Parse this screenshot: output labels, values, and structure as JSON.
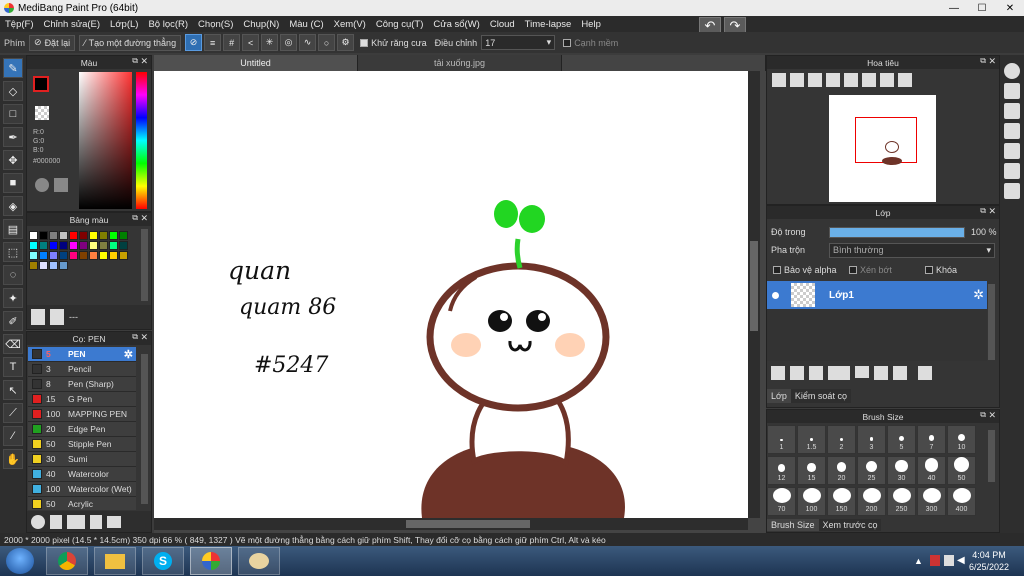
{
  "window": {
    "title": "MediBang Paint Pro (64bit)"
  },
  "menu": [
    "Tệp(F)",
    "Chỉnh sửa(E)",
    "Lớp(L)",
    "Bộ lọc(R)",
    "Chọn(S)",
    "Chụp(N)",
    "Màu (C)",
    "Xem(V)",
    "Công cụ(T)",
    "Cửa sổ(W)",
    "Cloud",
    "Time-lapse",
    "Help"
  ],
  "toolbar": {
    "label": "Phím",
    "reset": "Đặt lại",
    "make_line": "Tạo một đường thẳng",
    "antialias": "Khử răng cưa",
    "adjust_label": "Điều chỉnh",
    "adjust_value": "17",
    "smooth_edge": "Cạnh mềm"
  },
  "color_panel": {
    "title": "Màu",
    "rgb": [
      "R:0",
      "G:0",
      "B:0"
    ],
    "hex": "#000000",
    "current_color": "#000000"
  },
  "palette_panel": {
    "title": "Bảng màu",
    "colors": [
      "#ffffff",
      "#000000",
      "#808080",
      "#c0c0c0",
      "#ff0000",
      "#800000",
      "#ffff00",
      "#808000",
      "#00ff00",
      "#008000",
      "#00ffff",
      "#008080",
      "#0000ff",
      "#000080",
      "#ff00ff",
      "#800080",
      "#ffff80",
      "#808040",
      "#00ff80",
      "#004040",
      "#80ffff",
      "#0080ff",
      "#8080ff",
      "#004080",
      "#ff0080",
      "#804000",
      "#ff8040",
      "#ffff00",
      "#ffd000",
      "#c8a000",
      "#a08000",
      "#e0e0ff",
      "#a0c0ff",
      "#6699cc"
    ],
    "footer": "---"
  },
  "brush_panel": {
    "title": "Cọ: PEN",
    "brushes": [
      {
        "size": "5",
        "name": "PEN",
        "color": "#333333"
      },
      {
        "size": "3",
        "name": "Pencil",
        "color": "#333333"
      },
      {
        "size": "8",
        "name": "Pen (Sharp)",
        "color": "#333333"
      },
      {
        "size": "15",
        "name": "G Pen",
        "color": "#e02020"
      },
      {
        "size": "100",
        "name": "MAPPING PEN",
        "color": "#e02020"
      },
      {
        "size": "20",
        "name": "Edge Pen",
        "color": "#20a020"
      },
      {
        "size": "50",
        "name": "Stipple Pen",
        "color": "#f0d020"
      },
      {
        "size": "30",
        "name": "Sumi",
        "color": "#f0d020"
      },
      {
        "size": "40",
        "name": "Watercolor",
        "color": "#40b0e0"
      },
      {
        "size": "100",
        "name": "Watercolor (Wet)",
        "color": "#40b0e0"
      },
      {
        "size": "50",
        "name": "Acrylic",
        "color": "#f0d020"
      }
    ]
  },
  "tabs": [
    "Untitled",
    "tải xuống.jpg"
  ],
  "canvas": {
    "handwriting": [
      "quan",
      "quam 86",
      "#5247"
    ]
  },
  "navigator": {
    "title": "Hoa tiêu"
  },
  "layer_panel": {
    "title": "Lớp",
    "opacity_label": "Độ trong",
    "opacity_value": "100 %",
    "opacity_fraction": 1.0,
    "blend_label": "Pha trộn",
    "blend_value": "Bình thường",
    "protect_alpha": "Bảo vệ alpha",
    "clipping": "Xén bớt",
    "lock": "Khóa",
    "layer_name": "Lớp1",
    "tab_layer": "Lớp",
    "tab_control": "Kiểm soát cọ"
  },
  "brush_size_panel": {
    "title": "Brush Size",
    "sizes": [
      "1",
      "1.5",
      "2",
      "3",
      "5",
      "7",
      "10",
      "12",
      "15",
      "20",
      "25",
      "30",
      "40",
      "50",
      "70",
      "100",
      "150",
      "200",
      "250",
      "300",
      "400"
    ],
    "tab_size": "Brush Size",
    "tab_preview": "Xem trước cọ"
  },
  "status": "2000 * 2000 pixel  (14.5 * 14.5cm)  350 dpi  66 %  ( 849, 1327 )  Vẽ một đường thẳng bằng cách giữ phím Shift, Thay đổi cỡ cọ bằng cách giữ phím Ctrl, Alt và kéo",
  "taskbar": {
    "time": "4:04 PM",
    "date": "6/25/2022"
  }
}
